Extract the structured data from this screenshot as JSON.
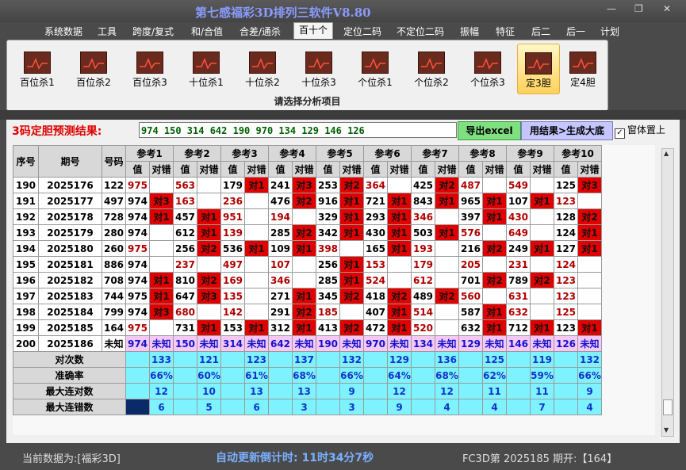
{
  "app": {
    "title": "第七感福彩3D排列三软件V8.80",
    "window_controls": [
      "—",
      "❐",
      "✕"
    ]
  },
  "menu": [
    {
      "label": "系统数据"
    },
    {
      "label": "工具"
    },
    {
      "label": "跨度/复式"
    },
    {
      "label": "和/合值"
    },
    {
      "label": "合差/通杀"
    },
    {
      "label": "百十个",
      "active": true
    },
    {
      "label": "定位二码"
    },
    {
      "label": "不定位二码"
    },
    {
      "label": "振幅"
    },
    {
      "label": "特征"
    },
    {
      "label": "后二"
    },
    {
      "label": "后一"
    },
    {
      "label": "计划"
    }
  ],
  "ribbon": {
    "buttons": [
      {
        "label": "百位杀1",
        "icon": "chart-icon"
      },
      {
        "label": "百位杀2",
        "icon": "chart-icon"
      },
      {
        "label": "百位杀3",
        "icon": "chart-icon"
      },
      {
        "label": "十位杀1",
        "icon": "chart-icon"
      },
      {
        "label": "十位杀2",
        "icon": "chart-icon"
      },
      {
        "label": "十位杀3",
        "icon": "chart-icon"
      },
      {
        "label": "个位杀1",
        "icon": "chart-icon"
      },
      {
        "label": "个位杀2",
        "icon": "chart-icon"
      },
      {
        "label": "个位杀3",
        "icon": "chart-icon"
      },
      {
        "label": "定3胆",
        "icon": "chart-icon",
        "selected": true
      },
      {
        "label": "定4胆",
        "icon": "chart-icon"
      }
    ],
    "caption": "请选择分析项目"
  },
  "prediction": {
    "label": "3码定胆预测结果:",
    "value": "974  150  314  642  190  970  134  129  146  126",
    "export_label": "导出excel",
    "generate_label": "用结果>生成大底",
    "topmost_label": "窗体置上",
    "topmost_checked": true
  },
  "table": {
    "headers": {
      "seq": "序号",
      "issue": "期号",
      "number": "号码",
      "value": "值",
      "hit": "对错"
    },
    "ref_groups": [
      "参考1",
      "参考2",
      "参考3",
      "参考4",
      "参考5",
      "参考6",
      "参考7",
      "参考8",
      "参考9",
      "参考10"
    ],
    "rows": [
      {
        "seq": "190",
        "issue": "2025176",
        "number": "122",
        "cells": [
          [
            "975",
            ""
          ],
          [
            "563",
            ""
          ],
          [
            "179",
            "对1"
          ],
          [
            "241",
            "对3"
          ],
          [
            "253",
            "对2"
          ],
          [
            "364",
            ""
          ],
          [
            "425",
            "对2"
          ],
          [
            "487",
            ""
          ],
          [
            "549",
            ""
          ],
          [
            "125",
            "对3"
          ]
        ]
      },
      {
        "seq": "191",
        "issue": "2025177",
        "number": "497",
        "cells": [
          [
            "974",
            "对3"
          ],
          [
            "163",
            ""
          ],
          [
            "236",
            ""
          ],
          [
            "476",
            "对2"
          ],
          [
            "916",
            "对1"
          ],
          [
            "721",
            "对1"
          ],
          [
            "843",
            "对1"
          ],
          [
            "965",
            "对1"
          ],
          [
            "107",
            "对1"
          ],
          [
            "123",
            ""
          ]
        ]
      },
      {
        "seq": "192",
        "issue": "2025178",
        "number": "728",
        "cells": [
          [
            "974",
            "对1"
          ],
          [
            "457",
            "对1"
          ],
          [
            "951",
            ""
          ],
          [
            "194",
            ""
          ],
          [
            "329",
            "对1"
          ],
          [
            "293",
            "对1"
          ],
          [
            "346",
            ""
          ],
          [
            "397",
            "对1"
          ],
          [
            "430",
            ""
          ],
          [
            "128",
            "对2"
          ]
        ]
      },
      {
        "seq": "193",
        "issue": "2025179",
        "number": "280",
        "cells": [
          [
            "974",
            ""
          ],
          [
            "612",
            "对1"
          ],
          [
            "139",
            ""
          ],
          [
            "285",
            "对2"
          ],
          [
            "342",
            "对1"
          ],
          [
            "430",
            "对1"
          ],
          [
            "503",
            "对1"
          ],
          [
            "576",
            ""
          ],
          [
            "649",
            ""
          ],
          [
            "124",
            "对1"
          ]
        ]
      },
      {
        "seq": "194",
        "issue": "2025180",
        "number": "260",
        "cells": [
          [
            "975",
            ""
          ],
          [
            "256",
            "对2"
          ],
          [
            "536",
            "对1"
          ],
          [
            "109",
            "对1"
          ],
          [
            "398",
            ""
          ],
          [
            "165",
            "对1"
          ],
          [
            "193",
            ""
          ],
          [
            "216",
            "对2"
          ],
          [
            "249",
            "对1"
          ],
          [
            "127",
            "对1"
          ]
        ]
      },
      {
        "seq": "195",
        "issue": "2025181",
        "number": "886",
        "cells": [
          [
            "974",
            ""
          ],
          [
            "237",
            ""
          ],
          [
            "497",
            ""
          ],
          [
            "107",
            ""
          ],
          [
            "256",
            "对1"
          ],
          [
            "153",
            ""
          ],
          [
            "179",
            ""
          ],
          [
            "205",
            ""
          ],
          [
            "231",
            ""
          ],
          [
            "124",
            ""
          ]
        ]
      },
      {
        "seq": "196",
        "issue": "2025182",
        "number": "708",
        "cells": [
          [
            "974",
            "对1"
          ],
          [
            "810",
            "对2"
          ],
          [
            "169",
            ""
          ],
          [
            "346",
            ""
          ],
          [
            "285",
            "对1"
          ],
          [
            "524",
            ""
          ],
          [
            "612",
            ""
          ],
          [
            "701",
            "对2"
          ],
          [
            "789",
            "对2"
          ],
          [
            "123",
            ""
          ]
        ]
      },
      {
        "seq": "197",
        "issue": "2025183",
        "number": "744",
        "cells": [
          [
            "975",
            "对1"
          ],
          [
            "647",
            "对3"
          ],
          [
            "135",
            ""
          ],
          [
            "271",
            "对1"
          ],
          [
            "345",
            "对2"
          ],
          [
            "418",
            "对2"
          ],
          [
            "489",
            "对2"
          ],
          [
            "560",
            ""
          ],
          [
            "631",
            ""
          ],
          [
            "123",
            ""
          ]
        ]
      },
      {
        "seq": "198",
        "issue": "2025184",
        "number": "799",
        "cells": [
          [
            "974",
            "对3"
          ],
          [
            "680",
            ""
          ],
          [
            "142",
            ""
          ],
          [
            "291",
            "对2"
          ],
          [
            "185",
            ""
          ],
          [
            "407",
            "对1"
          ],
          [
            "514",
            ""
          ],
          [
            "587",
            "对1"
          ],
          [
            "632",
            ""
          ],
          [
            "125",
            ""
          ]
        ]
      },
      {
        "seq": "199",
        "issue": "2025185",
        "number": "164",
        "cells": [
          [
            "975",
            ""
          ],
          [
            "731",
            "对1"
          ],
          [
            "153",
            "对1"
          ],
          [
            "312",
            "对1"
          ],
          [
            "413",
            "对2"
          ],
          [
            "472",
            "对1"
          ],
          [
            "520",
            ""
          ],
          [
            "632",
            "对1"
          ],
          [
            "712",
            "对1"
          ],
          [
            "123",
            "对1"
          ]
        ]
      }
    ],
    "pending_row": {
      "seq": "200",
      "issue": "2025186",
      "number": "未知",
      "cells": [
        [
          "974",
          "未知"
        ],
        [
          "150",
          "未知"
        ],
        [
          "314",
          "未知"
        ],
        [
          "642",
          "未知"
        ],
        [
          "190",
          "未知"
        ],
        [
          "970",
          "未知"
        ],
        [
          "134",
          "未知"
        ],
        [
          "129",
          "未知"
        ],
        [
          "146",
          "未知"
        ],
        [
          "126",
          "未知"
        ]
      ]
    },
    "stats": [
      {
        "label": "对次数",
        "values": [
          "133",
          "121",
          "123",
          "137",
          "132",
          "129",
          "136",
          "125",
          "119",
          "132"
        ]
      },
      {
        "label": "准确率",
        "values": [
          "66%",
          "60%",
          "61%",
          "68%",
          "66%",
          "64%",
          "68%",
          "62%",
          "59%",
          "66%"
        ]
      },
      {
        "label": "最大连对数",
        "values": [
          "12",
          "10",
          "13",
          "13",
          "9",
          "12",
          "12",
          "11",
          "11",
          "9"
        ]
      },
      {
        "label": "最大连错数",
        "values": [
          "6",
          "5",
          "6",
          "3",
          "3",
          "9",
          "4",
          "4",
          "7",
          "4"
        ]
      }
    ]
  },
  "status": {
    "current_data": "当前数据为:[福彩3D]",
    "countdown": "自动更新倒计时: 11时34分7秒",
    "issue_info": "FC3D第 2025185 期开:【164】"
  },
  "colors": {
    "hit": "#e00000",
    "pending": "#f5c8f5",
    "stats": "#7ff2ff",
    "title": "#8a9bff"
  }
}
